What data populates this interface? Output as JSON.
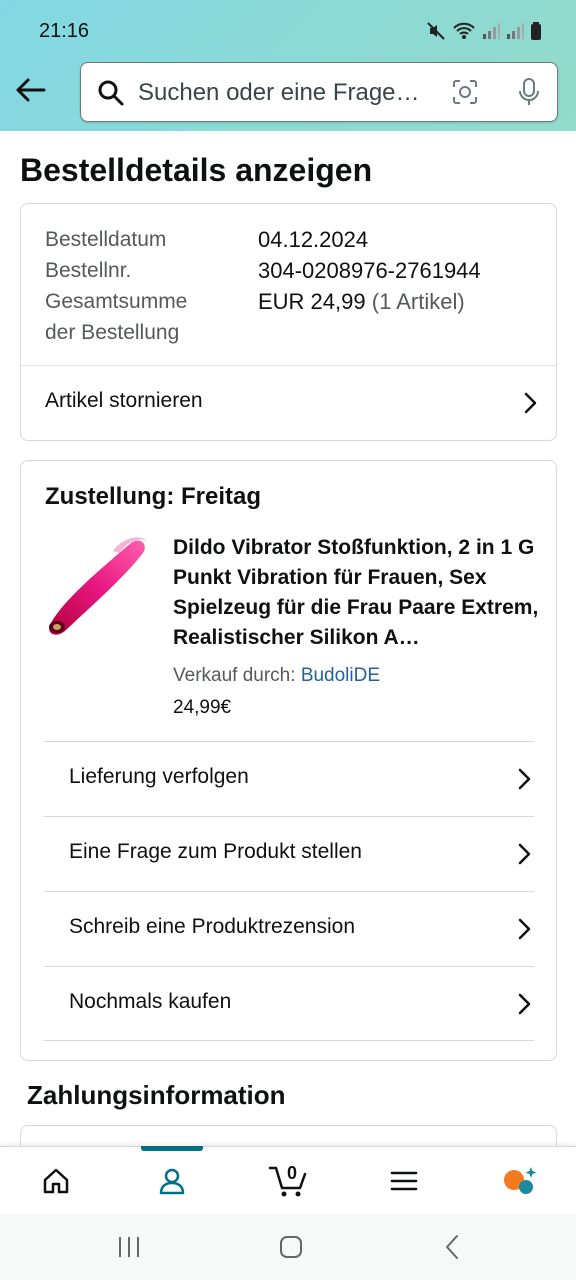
{
  "status_bar": {
    "time": "21:16"
  },
  "search": {
    "placeholder": "Suchen oder eine Frage…"
  },
  "page": {
    "title": "Bestelldetails anzeigen"
  },
  "order_summary": {
    "order_date_label": "Bestelldatum",
    "order_date_value": "04.12.2024",
    "order_number_label": "Bestellnr.",
    "order_number_value": "304-0208976-2761944",
    "total_label_line1": "Gesamtsumme",
    "total_label_line2": "der Bestellung",
    "total_value": "EUR 24,99",
    "total_items": "(1 Artikel)",
    "cancel_label": "Artikel stornieren"
  },
  "shipment": {
    "title": "Zustellung: Freitag",
    "product_title": "Dildo Vibrator Stoßfunktion, 2 in 1 G Punkt Vibration für Frauen, Sex Spielzeug für die Frau Paare Extrem, Realistischer Silikon A…",
    "seller_prefix": "Verkauf durch:",
    "seller_name": "BudoliDE",
    "price": "24,99€",
    "actions": [
      {
        "label": "Lieferung verfolgen"
      },
      {
        "label": "Eine Frage zum Produkt stellen"
      },
      {
        "label": "Schreib eine Produktrezension"
      },
      {
        "label": "Nochmals kaufen"
      }
    ]
  },
  "payment": {
    "title": "Zahlungsinformation"
  },
  "bottom_nav": {
    "cart_count": "0",
    "accent_color": "#007185",
    "items": [
      "home-icon",
      "account-icon",
      "cart-icon",
      "menu-icon",
      "rufus-ai-icon"
    ]
  }
}
